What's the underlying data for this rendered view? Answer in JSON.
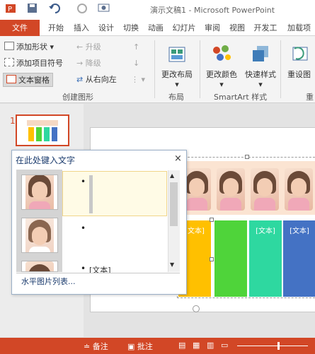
{
  "title": "演示文稿1 - Microsoft PowerPoint",
  "ribbon_tabs": [
    "文件",
    "开始",
    "插入",
    "设计",
    "切换",
    "动画",
    "幻灯片",
    "审阅",
    "视图",
    "开发工",
    "加载项"
  ],
  "create_graphic": {
    "add_shape": "添加形状",
    "add_bullet": "添加项目符号",
    "text_pane": "文本窗格",
    "promote": "升级",
    "demote": "降级",
    "rtl": "从右向左",
    "group_label": "创建图形"
  },
  "layout_group": {
    "change_layout": "更改布局",
    "group_label": "布局"
  },
  "smartart_group": {
    "change_colors": "更改颜色",
    "quick_styles": "快速样式",
    "group_label": "SmartArt 样式"
  },
  "reset_group": {
    "reset": "重设图",
    "group_label": "重"
  },
  "slide_number": "1",
  "text_pane": {
    "title": "在此处键入文字",
    "close": "×",
    "bullet": "•",
    "item3": "[文本]",
    "footer": "水平图片列表..."
  },
  "bar_labels": [
    "[文本]",
    "[文本]",
    "[文本]"
  ],
  "bar_colors": [
    "#ffc000",
    "#4fd43a",
    "#2ed8a0",
    "#4472c4"
  ],
  "status": {
    "notes": "备注",
    "comments": "批注"
  },
  "icons": [
    "save-icon",
    "undo-icon",
    "redo-icon",
    "add-shape-icon",
    "add-bullet-icon",
    "text-pane-icon",
    "promote-icon",
    "demote-icon",
    "rtl-icon",
    "layout-icon",
    "color-icon",
    "quick-style-icon",
    "reset-icon",
    "close-icon",
    "notes-icon",
    "comments-icon"
  ]
}
